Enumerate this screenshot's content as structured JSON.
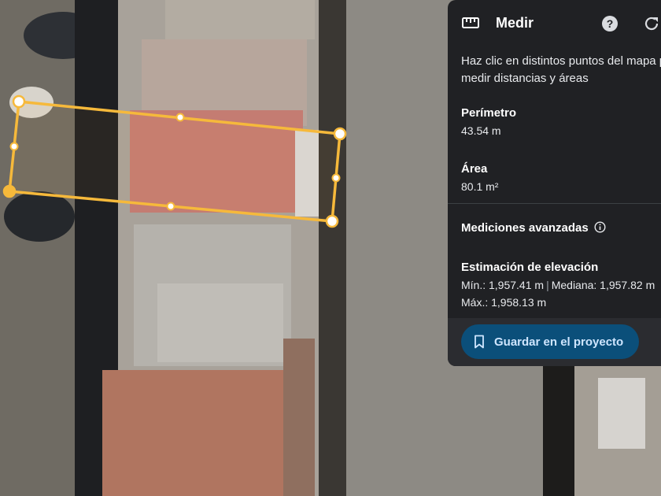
{
  "panel": {
    "icon": "ruler-icon",
    "title": "Medir",
    "help_icon": "help-icon",
    "refresh_icon": "refresh-icon",
    "instructions": "Haz clic en distintos puntos del mapa para medir distancias y áreas",
    "perimeter": {
      "label": "Perímetro",
      "value": "43.54 m"
    },
    "area": {
      "label": "Área",
      "value": "80.1 m²"
    },
    "advanced": {
      "label": "Mediciones avanzadas",
      "icon": "info-icon"
    },
    "elevation": {
      "label": "Estimación de elevación",
      "min": "Mín.: 1,957.41 m",
      "separator": "|",
      "median": "Mediana: 1,957.82 m",
      "max": "Máx.: 1,958.13 m"
    },
    "save_button": {
      "label": "Guardar en el proyecto",
      "icon": "bookmark-icon"
    }
  },
  "colors": {
    "panel_bg": "#202124",
    "measure_line": "#f6b93b",
    "button_bg": "#0b4f7a",
    "button_text": "#cfe6ff"
  }
}
